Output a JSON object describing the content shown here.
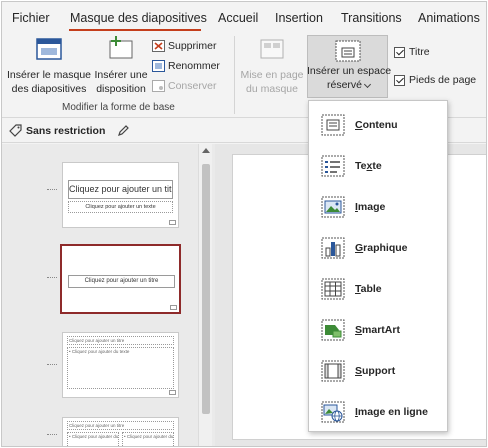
{
  "tabs": [
    {
      "label": "Fichier",
      "active": false
    },
    {
      "label": "Masque des diapositives",
      "active": true
    },
    {
      "label": "Accueil",
      "active": false
    },
    {
      "label": "Insertion",
      "active": false
    },
    {
      "label": "Transitions",
      "active": false
    },
    {
      "label": "Animations",
      "active": false
    }
  ],
  "ribbon": {
    "insert_master": {
      "line1": "Insérer le masque",
      "line2": "des diapositives"
    },
    "insert_layout": {
      "line1": "Insérer une",
      "line2": "disposition"
    },
    "delete_label": "Supprimer",
    "rename_label": "Renommer",
    "preserve_label": "Conserver",
    "group_label": "Modifier la forme de base",
    "master_layout": {
      "line1": "Mise en page",
      "line2": "du masque"
    },
    "insert_placeholder": {
      "line1": "Insérer un espace",
      "line2": "réservé"
    },
    "title_check": "Titre",
    "footer_check": "Pieds de page"
  },
  "restriction": {
    "label": "Sans restriction"
  },
  "thumbnails": [
    {
      "title": "Cliquez pour ajouter un titre",
      "subtitle": "Cliquez pour ajouter un texte"
    },
    {
      "title": "Cliquez pour ajouter un titre"
    },
    {
      "title": "Cliquez pour ajouter un titre",
      "body": "• Cliquez pour ajouter du texte"
    },
    {
      "title": "Cliquez pour ajouter un titre",
      "body": "• Cliquez pour ajouter du texte"
    }
  ],
  "dropdown": {
    "items": [
      {
        "accel": "C",
        "rest": "ontenu",
        "icon": "content-icon"
      },
      {
        "accel": "",
        "pre": "Te",
        "accel2": "x",
        "rest": "te",
        "icon": "text-icon"
      },
      {
        "accel": "I",
        "rest": "mage",
        "icon": "image-icon"
      },
      {
        "accel": "G",
        "rest": "raphique",
        "icon": "chart-icon"
      },
      {
        "accel": "T",
        "rest": "able",
        "icon": "table-icon"
      },
      {
        "accel": "S",
        "rest": "martArt",
        "icon": "smartart-icon"
      },
      {
        "accel": "S",
        "rest": "upport",
        "icon": "media-icon"
      },
      {
        "accel": "I",
        "rest": "mage en ligne",
        "icon": "online-image-icon"
      }
    ]
  },
  "colors": {
    "accent": "#c43e1c",
    "selected_border": "#8e2a2a",
    "icon_blue": "#2b579a",
    "icon_green": "#3d8b37"
  }
}
